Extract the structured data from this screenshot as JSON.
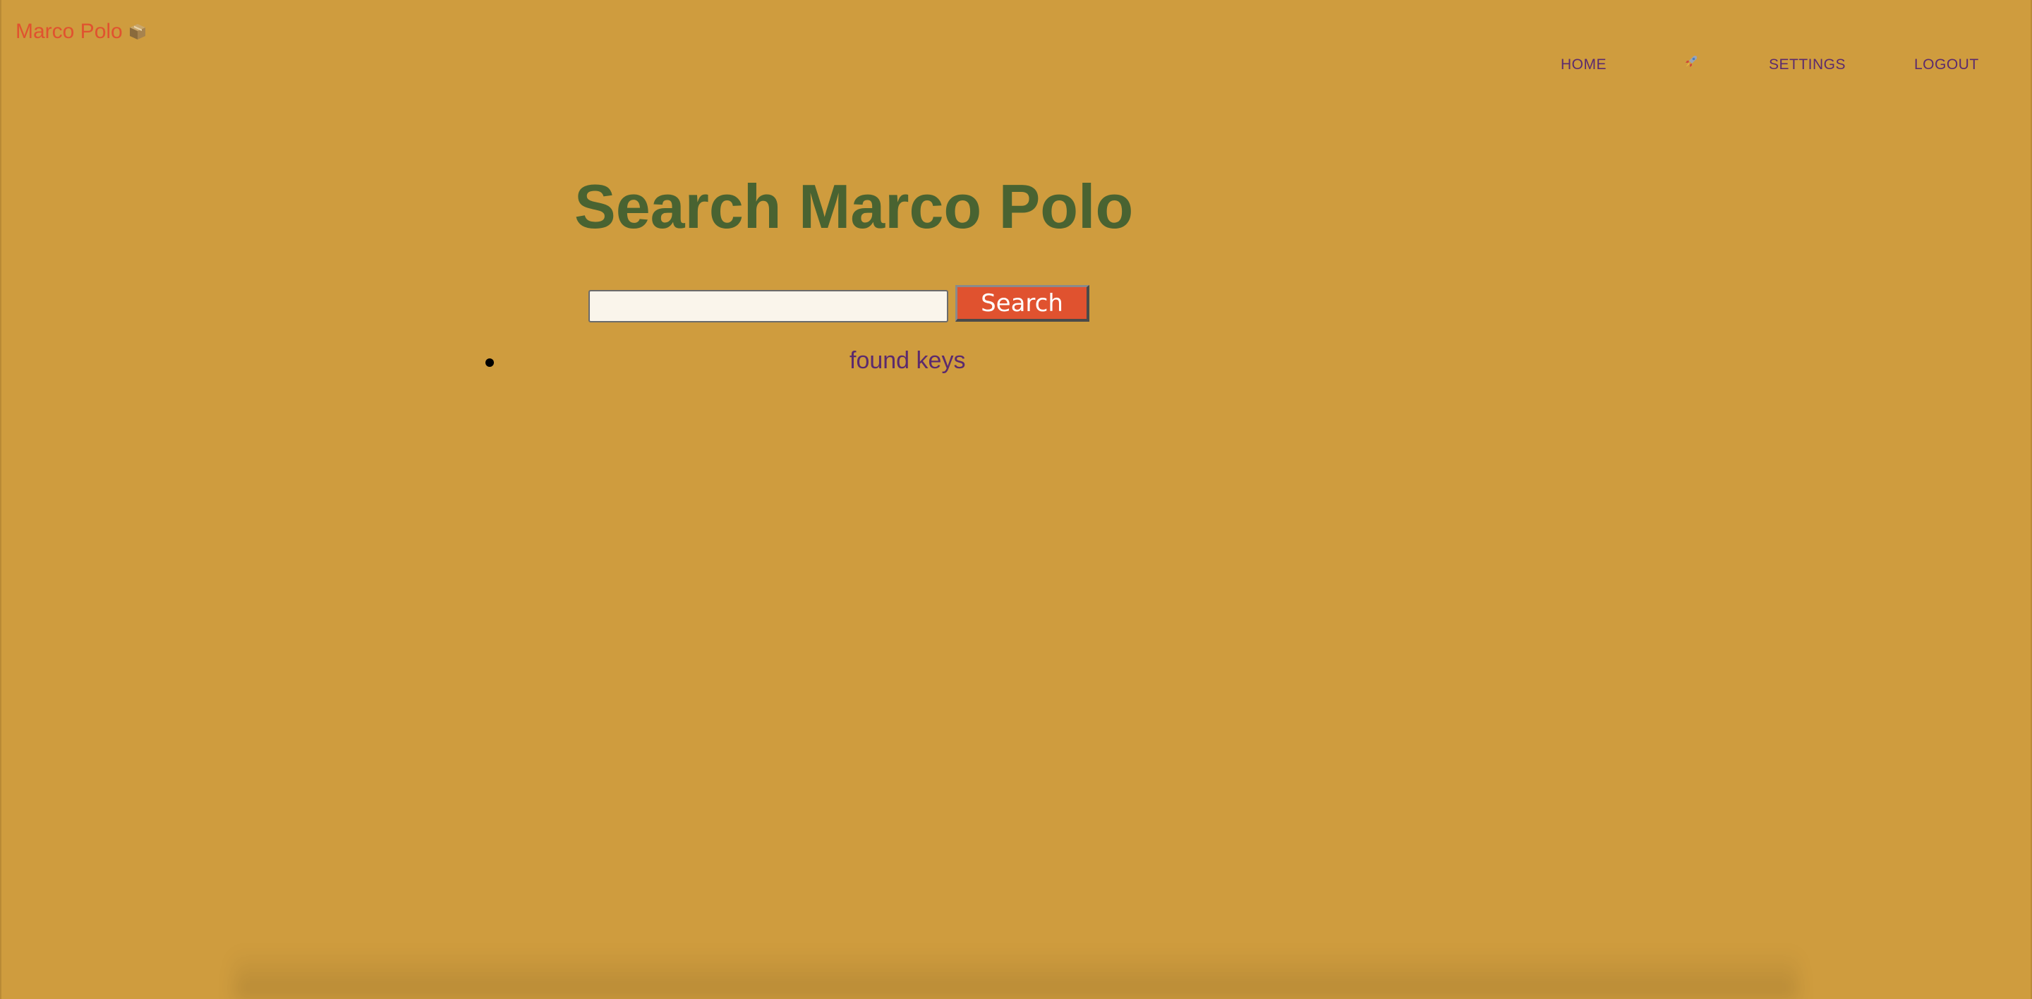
{
  "brand": {
    "name": "Marco Polo",
    "icon": "package-icon"
  },
  "nav": {
    "home": "HOME",
    "rocket_icon": "rocket-icon",
    "settings": "SETTINGS",
    "logout": "LOGOUT"
  },
  "main": {
    "title": "Search Marco Polo",
    "search": {
      "value": "",
      "placeholder": "",
      "button_label": "Search"
    },
    "results": [
      {
        "label": "found keys"
      }
    ]
  },
  "colors": {
    "background": "#CF9C3E",
    "brand": "#E0522F",
    "title": "#496331",
    "link": "#5B2A6E",
    "button": "#E0522F",
    "input_bg": "#FAF5EB"
  }
}
